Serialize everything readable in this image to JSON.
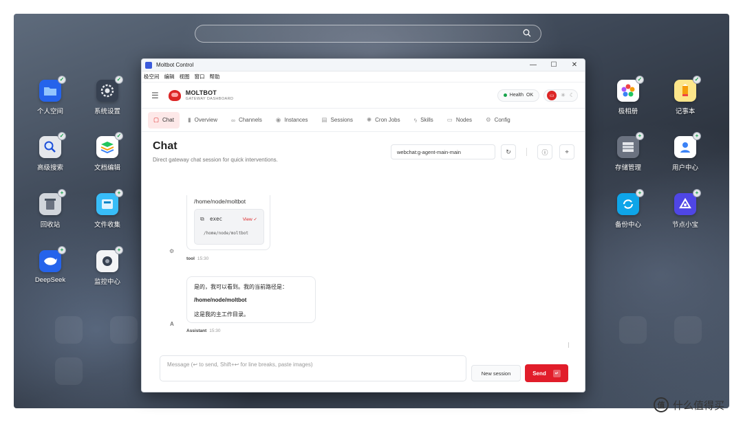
{
  "desktop": {
    "left_icons": [
      {
        "label": "个人空间",
        "icon": "folder-icon",
        "color": "#2563eb"
      },
      {
        "label": "系统设置",
        "icon": "settings-icon",
        "color": "#374151"
      },
      {
        "label": "高级搜索",
        "icon": "search-icon",
        "color": "#e5e7eb"
      },
      {
        "label": "文档编辑",
        "icon": "layers-icon",
        "color": "#22c55e"
      },
      {
        "label": "回收站",
        "icon": "trash-icon",
        "color": "#9ca3af"
      },
      {
        "label": "文件收集",
        "icon": "inbox-icon",
        "color": "#38bdf8"
      },
      {
        "label": "DeepSeek",
        "icon": "deepseek-whale-icon",
        "color": "#2563eb"
      },
      {
        "label": "监控中心",
        "icon": "camera-icon",
        "color": "#f3f4f6"
      }
    ],
    "right_icons": [
      {
        "label": "极相册",
        "icon": "photos-flower-icon",
        "color": "#ffffff"
      },
      {
        "label": "记事本",
        "icon": "notes-pencil-icon",
        "color": "#f59e0b"
      },
      {
        "label": "存储管理",
        "icon": "storage-server-icon",
        "color": "#6b7280"
      },
      {
        "label": "用户中心",
        "icon": "user-icon",
        "color": "#3b82f6"
      },
      {
        "label": "备份中心",
        "icon": "backup-sync-icon",
        "color": "#0ea5e9"
      },
      {
        "label": "节点小宝",
        "icon": "node-link-icon",
        "color": "#4f46e5"
      }
    ]
  },
  "window": {
    "title": "Moltbot Control",
    "menu": [
      "极空间",
      "编辑",
      "视图",
      "窗口",
      "帮助"
    ],
    "brand": {
      "name": "MOLTBOT",
      "subtitle": "GATEWAY DASHBOARD"
    },
    "health": {
      "label": "Health",
      "status": "OK"
    },
    "tabs": [
      {
        "label": "Chat",
        "icon": "chat-icon",
        "glyph": "▢",
        "active": true
      },
      {
        "label": "Overview",
        "icon": "bar-chart-icon",
        "glyph": "▮",
        "active": false
      },
      {
        "label": "Channels",
        "icon": "link-icon",
        "glyph": "∞",
        "active": false
      },
      {
        "label": "Instances",
        "icon": "broadcast-icon",
        "glyph": "◉",
        "active": false
      },
      {
        "label": "Sessions",
        "icon": "document-icon",
        "glyph": "▤",
        "active": false
      },
      {
        "label": "Cron Jobs",
        "icon": "loader-icon",
        "glyph": "✺",
        "active": false
      },
      {
        "label": "Skills",
        "icon": "bolt-icon",
        "glyph": "ϟ",
        "active": false
      },
      {
        "label": "Nodes",
        "icon": "monitor-icon",
        "glyph": "▭",
        "active": false
      },
      {
        "label": "Config",
        "icon": "gear-icon",
        "glyph": "⚙",
        "active": false
      }
    ],
    "page": {
      "title": "Chat",
      "subtitle": "Direct gateway chat session for quick interventions.",
      "session_key": "webchat:g-agent-main-main"
    },
    "messages": {
      "tool": {
        "path": "/home/node/moltbot",
        "exec_label": "exec",
        "view_label": "View ✓",
        "exec_path": "/home/node/moltbot",
        "sender": "tool",
        "time": "15:30"
      },
      "assistant": {
        "line1": "是的，我可以看到。我的当前路径是：",
        "line2": "/home/node/moltbot",
        "line3": "这是我的主工作目录。",
        "avatar": "A",
        "sender": "Assistant",
        "time": "15:30"
      }
    },
    "composer": {
      "placeholder": "Message (↩ to send, Shift+↩ for line breaks, paste images)",
      "new_session_label": "New session",
      "send_label": "Send",
      "send_kbd": "↵"
    }
  },
  "watermark": {
    "text": "什么值得买",
    "logo": "值"
  },
  "colors": {
    "accent": "#e11d2a",
    "health_dot": "#16a34a",
    "active_tab_bg": "#fde8e8"
  }
}
